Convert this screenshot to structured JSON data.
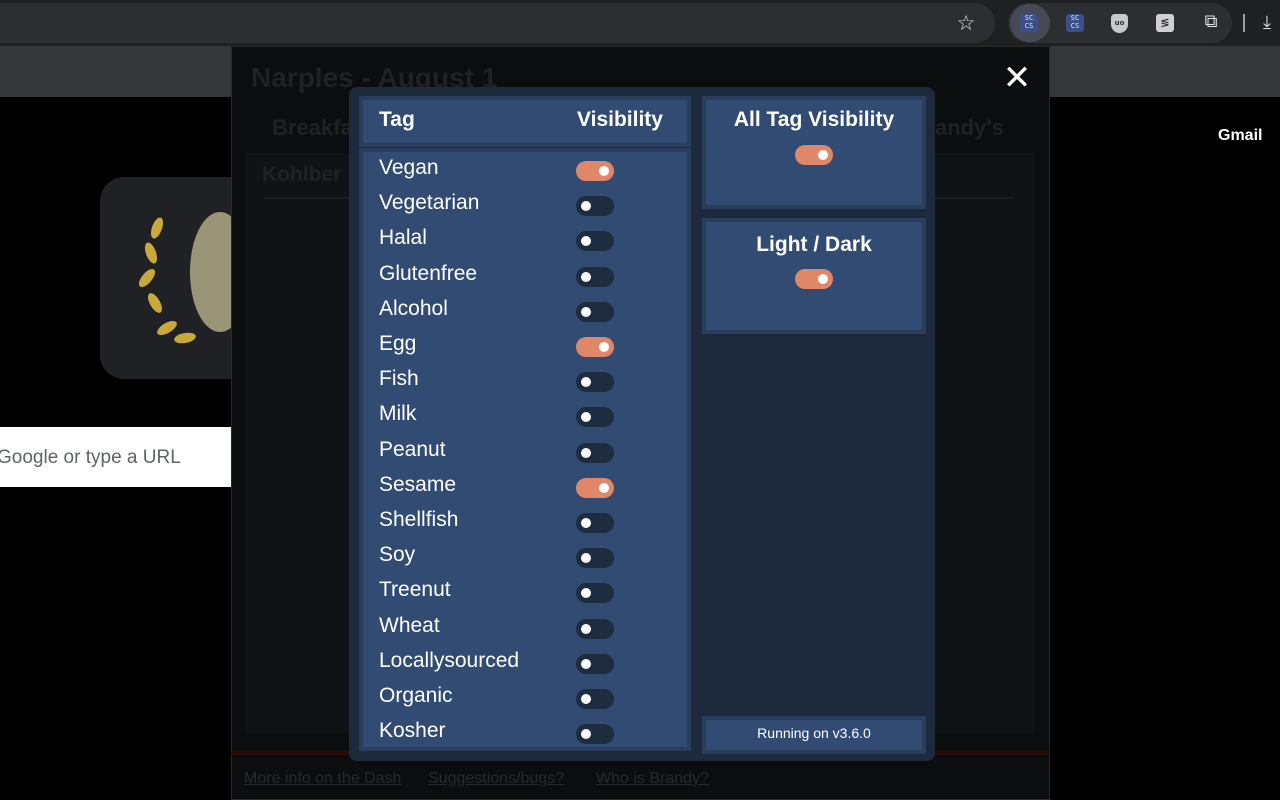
{
  "browser": {
    "icons": {
      "star": "star-icon",
      "ext1": "settings-extension-icon",
      "ext2": "settings-extension-icon",
      "ext3": "ublock-shield-icon",
      "ext4": "extension-logo-icon",
      "puzzle": "extensions-puzzle-icon",
      "download": "download-icon"
    }
  },
  "ntp": {
    "search_placeholder": "Google or type a URL",
    "gmail_link": "Gmail"
  },
  "background_page": {
    "title": "Narples - August 1",
    "tabs": [
      "Breakfa",
      "andy's"
    ],
    "hall": "Kohlber",
    "links": [
      "More info on the Dash",
      "Suggestions/bugs?",
      "Who is Brandy?"
    ]
  },
  "modal": {
    "close_label": "✕",
    "tag_header": "Tag",
    "visibility_header": "Visibility",
    "tags": [
      {
        "label": "Vegan",
        "on": true
      },
      {
        "label": "Vegetarian",
        "on": false
      },
      {
        "label": "Halal",
        "on": false
      },
      {
        "label": "Glutenfree",
        "on": false
      },
      {
        "label": "Alcohol",
        "on": false
      },
      {
        "label": "Egg",
        "on": true
      },
      {
        "label": "Fish",
        "on": false
      },
      {
        "label": "Milk",
        "on": false
      },
      {
        "label": "Peanut",
        "on": false
      },
      {
        "label": "Sesame",
        "on": true
      },
      {
        "label": "Shellfish",
        "on": false
      },
      {
        "label": "Soy",
        "on": false
      },
      {
        "label": "Treenut",
        "on": false
      },
      {
        "label": "Wheat",
        "on": false
      },
      {
        "label": "Locallysourced",
        "on": false
      },
      {
        "label": "Organic",
        "on": false
      },
      {
        "label": "Kosher",
        "on": false
      }
    ],
    "all_tag_visibility": {
      "label": "All Tag Visibility",
      "on": true
    },
    "light_dark": {
      "label": "Light / Dark",
      "on": true
    },
    "version": "Running on v3.6.0"
  },
  "colors": {
    "toggle_on": "#e0876a",
    "toggle_off": "#1e2c40",
    "panel": "#324b72",
    "modal_bg": "#1c2a3c"
  }
}
